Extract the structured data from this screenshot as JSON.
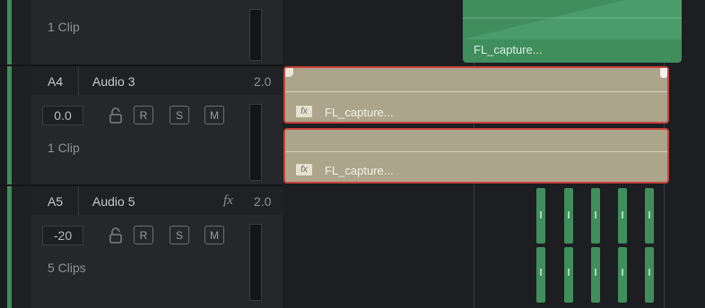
{
  "tracks": [
    {
      "clip_count": "1 Clip"
    },
    {
      "id": "A4",
      "name": "Audio 3",
      "fx": "",
      "channel": "2.0",
      "volume": "0.0",
      "buttons": [
        "R",
        "S",
        "M"
      ],
      "clip_count": "1 Clip"
    },
    {
      "id": "A5",
      "name": "Audio 5",
      "fx": "fx",
      "channel": "2.0",
      "volume": "-20",
      "buttons": [
        "R",
        "S",
        "M"
      ],
      "clip_count": "5 Clips"
    }
  ],
  "clips": {
    "green_top": "FL_capture...",
    "a4_upper": "FL_capture...",
    "a4_lower": "FL_capture...",
    "fx_badge": "fx"
  },
  "colors": {
    "clip_audio": "#aca58b",
    "clip_selected_border": "#c8433c",
    "clip_green": "#3f8e5c",
    "track_bg": "#25272b"
  }
}
